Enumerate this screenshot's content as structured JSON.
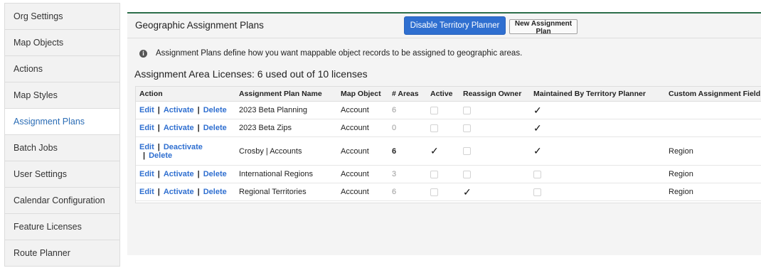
{
  "sidebar": {
    "items": [
      {
        "label": "Org Settings",
        "active": false
      },
      {
        "label": "Map Objects",
        "active": false
      },
      {
        "label": "Actions",
        "active": false
      },
      {
        "label": "Map Styles",
        "active": false
      },
      {
        "label": "Assignment Plans",
        "active": true
      },
      {
        "label": "Batch Jobs",
        "active": false
      },
      {
        "label": "User Settings",
        "active": false
      },
      {
        "label": "Calendar Configuration",
        "active": false
      },
      {
        "label": "Feature Licenses",
        "active": false
      },
      {
        "label": "Route Planner",
        "active": false
      }
    ]
  },
  "header": {
    "title": "Geographic Assignment Plans",
    "disable_button": "Disable Territory Planner",
    "new_button": "New Assignment Plan"
  },
  "info": {
    "icon": "info-icon",
    "glyph": "i",
    "text": "Assignment Plans define how you want mappable object records to be assigned to geographic areas."
  },
  "licenses": "Assignment Area Licenses: 6 used out of 10 licenses",
  "table": {
    "columns": [
      "Action",
      "Assignment Plan Name",
      "Map Object",
      "# Areas",
      "Active",
      "Reassign Owner",
      "Maintained By Territory Planner",
      "Custom Assignment Field"
    ],
    "separator": "|",
    "check_glyph": "✓",
    "rows": [
      {
        "edit": "Edit",
        "toggle": "Activate",
        "delete": "Delete",
        "name": "2023 Beta Planning",
        "object": "Account",
        "areas": "6",
        "areas_strong": false,
        "active": false,
        "reassign": false,
        "maintained": true,
        "custom_field": ""
      },
      {
        "edit": "Edit",
        "toggle": "Activate",
        "delete": "Delete",
        "name": "2023 Beta Zips",
        "object": "Account",
        "areas": "0",
        "areas_strong": false,
        "active": false,
        "reassign": false,
        "maintained": true,
        "custom_field": ""
      },
      {
        "edit": "Edit",
        "toggle": "Deactivate",
        "delete": "Delete",
        "name": "Crosby | Accounts",
        "object": "Account",
        "areas": "6",
        "areas_strong": true,
        "active": true,
        "reassign": false,
        "maintained": true,
        "custom_field": "Region"
      },
      {
        "edit": "Edit",
        "toggle": "Activate",
        "delete": "Delete",
        "name": "International Regions",
        "object": "Account",
        "areas": "3",
        "areas_strong": false,
        "active": false,
        "reassign": false,
        "maintained": false,
        "custom_field": "Region"
      },
      {
        "edit": "Edit",
        "toggle": "Activate",
        "delete": "Delete",
        "name": "Regional Territories",
        "object": "Account",
        "areas": "6",
        "areas_strong": false,
        "active": false,
        "reassign": true,
        "maintained": false,
        "custom_field": "Region"
      }
    ]
  }
}
